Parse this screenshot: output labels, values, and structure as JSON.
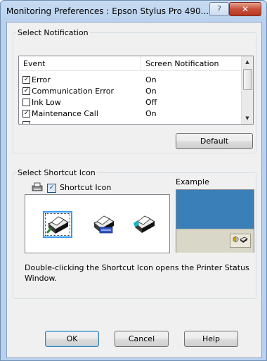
{
  "window": {
    "title": "Monitoring Preferences : Epson Stylus Pro 490...",
    "help_button": "?",
    "close_button": "✕"
  },
  "notification_group": {
    "label": "Select Notification",
    "columns": [
      "Event",
      "Screen Notification"
    ],
    "rows": [
      {
        "event": "Error",
        "checked": true,
        "notification": "On"
      },
      {
        "event": "Communication Error",
        "checked": true,
        "notification": "On"
      },
      {
        "event": "Ink Low",
        "checked": false,
        "notification": "Off"
      },
      {
        "event": "Maintenance Call",
        "checked": true,
        "notification": "On"
      }
    ],
    "default_button": "Default"
  },
  "shortcut_group": {
    "label": "Select Shortcut Icon",
    "checkbox_label": "Shortcut Icon",
    "checkbox_checked": true,
    "icons": [
      "printer-icon-default",
      "printer-icon-network",
      "printer-icon-color"
    ],
    "selected_icon_index": 0,
    "example_label": "Example",
    "description": "Double-clicking the Shortcut Icon opens the Printer Status Window."
  },
  "buttons": {
    "ok": "OK",
    "cancel": "Cancel",
    "help": "Help"
  },
  "colors": {
    "accent": "#3b7fb8",
    "taskbar": "#d9d7c8"
  }
}
